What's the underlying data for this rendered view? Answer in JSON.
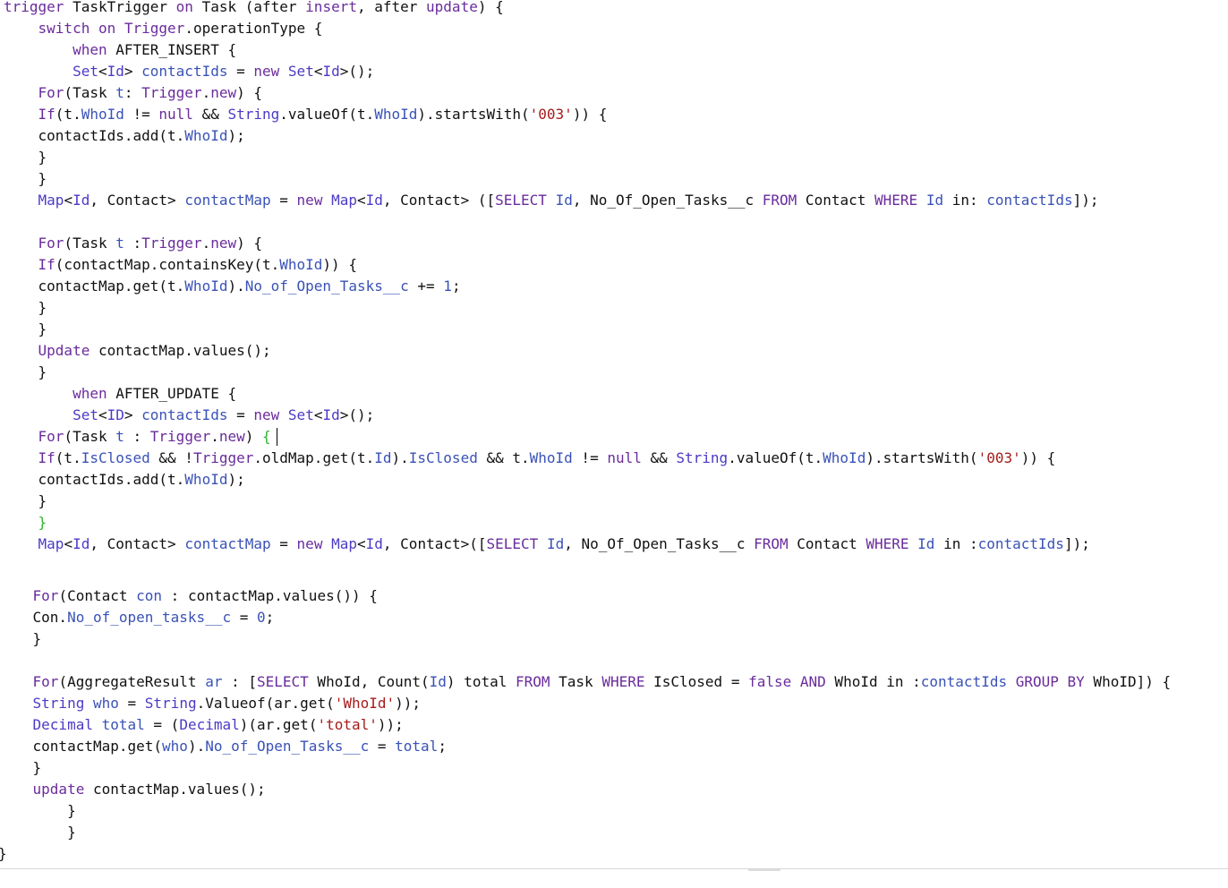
{
  "editor": {
    "language": "apex",
    "cursor_line": 21,
    "lines": [
      [
        [
          "kw",
          "trigger"
        ],
        [
          "plain",
          " TaskTrigger "
        ],
        [
          "kw",
          "on"
        ],
        [
          "plain",
          " Task (after "
        ],
        [
          "kw",
          "insert"
        ],
        [
          "plain",
          ", after "
        ],
        [
          "kw",
          "update"
        ],
        [
          "plain",
          ") {"
        ]
      ],
      [
        [
          "plain",
          "    "
        ],
        [
          "kw",
          "switch on"
        ],
        [
          "plain",
          " "
        ],
        [
          "kw",
          "Trigger"
        ],
        [
          "plain",
          ".operationType {"
        ]
      ],
      [
        [
          "plain",
          "        "
        ],
        [
          "kw",
          "when"
        ],
        [
          "plain",
          " AFTER_INSERT {"
        ]
      ],
      [
        [
          "plain",
          "        "
        ],
        [
          "type",
          "Set"
        ],
        [
          "plain",
          "<"
        ],
        [
          "type",
          "Id"
        ],
        [
          "plain",
          "> "
        ],
        [
          "var",
          "contactIds"
        ],
        [
          "plain",
          " = "
        ],
        [
          "kw",
          "new"
        ],
        [
          "plain",
          " "
        ],
        [
          "type",
          "Set"
        ],
        [
          "plain",
          "<"
        ],
        [
          "type",
          "Id"
        ],
        [
          "plain",
          ">();"
        ]
      ],
      [
        [
          "plain",
          "    "
        ],
        [
          "kw",
          "For"
        ],
        [
          "plain",
          "(Task "
        ],
        [
          "var",
          "t"
        ],
        [
          "plain",
          ": "
        ],
        [
          "kw",
          "Trigger"
        ],
        [
          "plain",
          "."
        ],
        [
          "kw",
          "new"
        ],
        [
          "plain",
          ") {"
        ]
      ],
      [
        [
          "plain",
          "    "
        ],
        [
          "kw",
          "If"
        ],
        [
          "plain",
          "(t."
        ],
        [
          "var",
          "WhoId"
        ],
        [
          "plain",
          " != "
        ],
        [
          "kw",
          "null"
        ],
        [
          "plain",
          " && "
        ],
        [
          "type",
          "String"
        ],
        [
          "plain",
          ".valueOf(t."
        ],
        [
          "var",
          "WhoId"
        ],
        [
          "plain",
          ").startsWith("
        ],
        [
          "str",
          "'003'"
        ],
        [
          "plain",
          ")) {"
        ]
      ],
      [
        [
          "plain",
          "    contactIds.add(t."
        ],
        [
          "var",
          "WhoId"
        ],
        [
          "plain",
          ");"
        ]
      ],
      [
        [
          "plain",
          "    }"
        ]
      ],
      [
        [
          "plain",
          "    }"
        ]
      ],
      [
        [
          "plain",
          "    "
        ],
        [
          "type",
          "Map"
        ],
        [
          "plain",
          "<"
        ],
        [
          "type",
          "Id"
        ],
        [
          "plain",
          ", Contact> "
        ],
        [
          "var",
          "contactMap"
        ],
        [
          "plain",
          " = "
        ],
        [
          "kw",
          "new"
        ],
        [
          "plain",
          " "
        ],
        [
          "type",
          "Map"
        ],
        [
          "plain",
          "<"
        ],
        [
          "type",
          "Id"
        ],
        [
          "plain",
          ", Contact> (["
        ],
        [
          "kw",
          "SELECT"
        ],
        [
          "plain",
          " "
        ],
        [
          "var",
          "Id"
        ],
        [
          "plain",
          ", No_Of_Open_Tasks__c "
        ],
        [
          "kw",
          "FROM"
        ],
        [
          "plain",
          " Contact "
        ],
        [
          "kw",
          "WHERE"
        ],
        [
          "plain",
          " "
        ],
        [
          "var",
          "Id"
        ],
        [
          "plain",
          " in: "
        ],
        [
          "var",
          "contactIds"
        ],
        [
          "plain",
          "]);"
        ]
      ],
      [],
      [
        [
          "plain",
          "    "
        ],
        [
          "kw",
          "For"
        ],
        [
          "plain",
          "(Task "
        ],
        [
          "var",
          "t"
        ],
        [
          "plain",
          " :"
        ],
        [
          "kw",
          "Trigger"
        ],
        [
          "plain",
          "."
        ],
        [
          "kw",
          "new"
        ],
        [
          "plain",
          ") {"
        ]
      ],
      [
        [
          "plain",
          "    "
        ],
        [
          "kw",
          "If"
        ],
        [
          "plain",
          "(contactMap.containsKey(t."
        ],
        [
          "var",
          "WhoId"
        ],
        [
          "plain",
          ")) {"
        ]
      ],
      [
        [
          "plain",
          "    contactMap.get(t."
        ],
        [
          "var",
          "WhoId"
        ],
        [
          "plain",
          ")."
        ],
        [
          "var",
          "No_of_Open_Tasks__c"
        ],
        [
          "plain",
          " += "
        ],
        [
          "var",
          "1"
        ],
        [
          "plain",
          ";"
        ]
      ],
      [
        [
          "plain",
          "    }"
        ]
      ],
      [
        [
          "plain",
          "    }"
        ]
      ],
      [
        [
          "plain",
          "    "
        ],
        [
          "kw",
          "Update"
        ],
        [
          "plain",
          " contactMap.values();"
        ]
      ],
      [
        [
          "plain",
          "    }"
        ]
      ],
      [
        [
          "plain",
          "        "
        ],
        [
          "kw",
          "when"
        ],
        [
          "plain",
          " AFTER_UPDATE {"
        ]
      ],
      [
        [
          "plain",
          "        "
        ],
        [
          "type",
          "Set"
        ],
        [
          "plain",
          "<"
        ],
        [
          "type",
          "ID"
        ],
        [
          "plain",
          "> "
        ],
        [
          "var",
          "contactIds"
        ],
        [
          "plain",
          " = "
        ],
        [
          "kw",
          "new"
        ],
        [
          "plain",
          " "
        ],
        [
          "type",
          "Set"
        ],
        [
          "plain",
          "<"
        ],
        [
          "type",
          "Id"
        ],
        [
          "plain",
          ">();"
        ]
      ],
      [
        [
          "plain",
          "    "
        ],
        [
          "kw",
          "For"
        ],
        [
          "plain",
          "(Task "
        ],
        [
          "var",
          "t"
        ],
        [
          "plain",
          " : "
        ],
        [
          "kw",
          "Trigger"
        ],
        [
          "plain",
          "."
        ],
        [
          "kw",
          "new"
        ],
        [
          "plain",
          ") "
        ],
        [
          "green",
          "{"
        ]
      ],
      [
        [
          "plain",
          "    "
        ],
        [
          "kw",
          "If"
        ],
        [
          "plain",
          "(t."
        ],
        [
          "var",
          "IsClosed"
        ],
        [
          "plain",
          " && !"
        ],
        [
          "kw",
          "Trigger"
        ],
        [
          "plain",
          ".oldMap.get(t."
        ],
        [
          "var",
          "Id"
        ],
        [
          "plain",
          ")."
        ],
        [
          "var",
          "IsClosed"
        ],
        [
          "plain",
          " && t."
        ],
        [
          "var",
          "WhoId"
        ],
        [
          "plain",
          " != "
        ],
        [
          "kw",
          "null"
        ],
        [
          "plain",
          " && "
        ],
        [
          "type",
          "String"
        ],
        [
          "plain",
          ".valueOf(t."
        ],
        [
          "var",
          "WhoId"
        ],
        [
          "plain",
          ").startsWith("
        ],
        [
          "str",
          "'003'"
        ],
        [
          "plain",
          ")) {"
        ]
      ],
      [
        [
          "plain",
          "    contactIds.add(t."
        ],
        [
          "var",
          "WhoId"
        ],
        [
          "plain",
          ");"
        ]
      ],
      [
        [
          "plain",
          "    }"
        ]
      ],
      [
        [
          "plain",
          "    "
        ],
        [
          "green",
          "}"
        ]
      ],
      [
        [
          "plain",
          "    "
        ],
        [
          "type",
          "Map"
        ],
        [
          "plain",
          "<"
        ],
        [
          "type",
          "Id"
        ],
        [
          "plain",
          ", Contact> "
        ],
        [
          "var",
          "contactMap"
        ],
        [
          "plain",
          " = "
        ],
        [
          "kw",
          "new"
        ],
        [
          "plain",
          " "
        ],
        [
          "type",
          "Map"
        ],
        [
          "plain",
          "<"
        ],
        [
          "type",
          "Id"
        ],
        [
          "plain",
          ", Contact>(["
        ],
        [
          "kw",
          "SELECT"
        ],
        [
          "plain",
          " "
        ],
        [
          "var",
          "Id"
        ],
        [
          "plain",
          ", No_Of_Open_Tasks__c "
        ],
        [
          "kw",
          "FROM"
        ],
        [
          "plain",
          " Contact "
        ],
        [
          "kw",
          "WHERE"
        ],
        [
          "plain",
          " "
        ],
        [
          "var",
          "Id"
        ],
        [
          "plain",
          " in :"
        ],
        [
          "var",
          "contactIds"
        ],
        [
          "plain",
          "]);"
        ]
      ],
      [],
      [
        [
          "plain",
          "    "
        ],
        [
          "kw",
          "For"
        ],
        [
          "plain",
          "(Contact "
        ],
        [
          "var",
          "con"
        ],
        [
          "plain",
          " : contactMap.values()) {"
        ]
      ],
      [
        [
          "plain",
          "    Con."
        ],
        [
          "var",
          "No_of_open_tasks__c"
        ],
        [
          "plain",
          " = "
        ],
        [
          "var",
          "0"
        ],
        [
          "plain",
          ";"
        ]
      ],
      [
        [
          "plain",
          "    }"
        ]
      ],
      [],
      [
        [
          "plain",
          "    "
        ],
        [
          "kw",
          "For"
        ],
        [
          "plain",
          "(AggregateResult "
        ],
        [
          "var",
          "ar"
        ],
        [
          "plain",
          " : ["
        ],
        [
          "kw",
          "SELECT"
        ],
        [
          "plain",
          " WhoId, Count("
        ],
        [
          "var",
          "Id"
        ],
        [
          "plain",
          ") total "
        ],
        [
          "kw",
          "FROM"
        ],
        [
          "plain",
          " Task "
        ],
        [
          "kw",
          "WHERE"
        ],
        [
          "plain",
          " IsClosed = "
        ],
        [
          "kw",
          "false"
        ],
        [
          "plain",
          " "
        ],
        [
          "kw",
          "AND"
        ],
        [
          "plain",
          " WhoId in :"
        ],
        [
          "var",
          "contactIds"
        ],
        [
          "plain",
          " "
        ],
        [
          "kw",
          "GROUP BY"
        ],
        [
          "plain",
          " WhoID]) {"
        ]
      ],
      [
        [
          "plain",
          "    "
        ],
        [
          "type",
          "String"
        ],
        [
          "plain",
          " "
        ],
        [
          "var",
          "who"
        ],
        [
          "plain",
          " = "
        ],
        [
          "type",
          "String"
        ],
        [
          "plain",
          ".Valueof(ar.get("
        ],
        [
          "str",
          "'WhoId'"
        ],
        [
          "plain",
          "));"
        ]
      ],
      [
        [
          "plain",
          "    "
        ],
        [
          "type",
          "Decimal"
        ],
        [
          "plain",
          " "
        ],
        [
          "var",
          "total"
        ],
        [
          "plain",
          " = ("
        ],
        [
          "type",
          "Decimal"
        ],
        [
          "plain",
          ")(ar.get("
        ],
        [
          "str",
          "'total'"
        ],
        [
          "plain",
          "));"
        ]
      ],
      [
        [
          "plain",
          "    contactMap.get("
        ],
        [
          "var",
          "who"
        ],
        [
          "plain",
          ")."
        ],
        [
          "var",
          "No_of_Open_Tasks__c"
        ],
        [
          "plain",
          " = "
        ],
        [
          "var",
          "total"
        ],
        [
          "plain",
          ";"
        ]
      ],
      [
        [
          "plain",
          "    }"
        ]
      ],
      [
        [
          "plain",
          "    "
        ],
        [
          "kw",
          "update"
        ],
        [
          "plain",
          " contactMap.values();"
        ]
      ],
      [
        [
          "plain",
          "        }"
        ]
      ],
      [
        [
          "plain",
          "        }"
        ]
      ],
      [
        [
          "plain",
          "}"
        ]
      ]
    ]
  }
}
